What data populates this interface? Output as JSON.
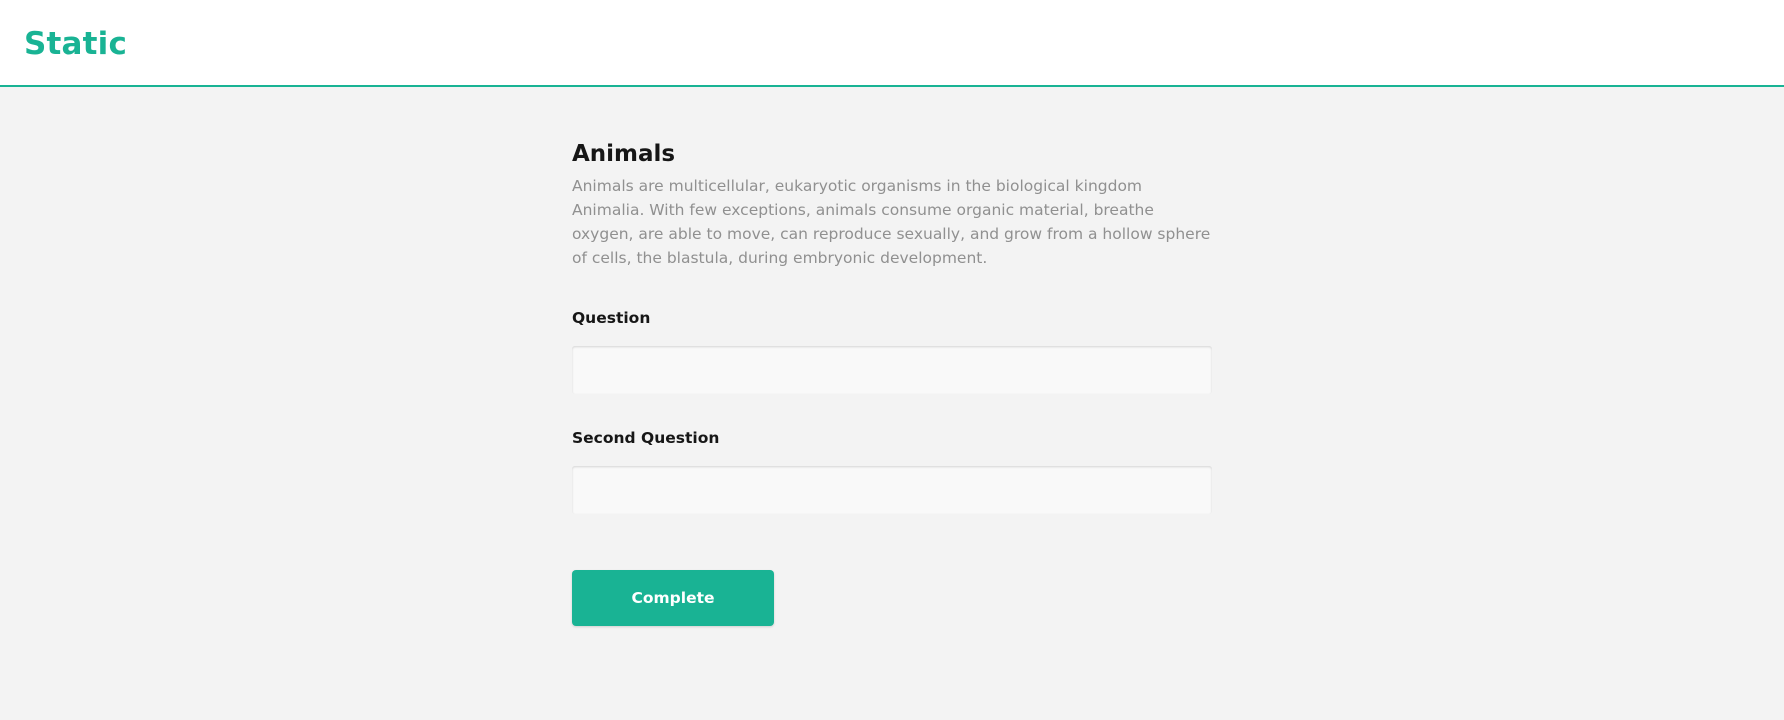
{
  "header": {
    "brand": "Static"
  },
  "survey": {
    "title": "Animals",
    "description": "Animals are multicellular, eukaryotic organisms in the biological kingdom Animalia. With few exceptions, animals consume organic material, breathe oxygen, are able to move, can reproduce sexually, and grow from a hollow sphere of cells, the blastula, during embryonic development.",
    "questions": [
      {
        "title": "Question",
        "value": ""
      },
      {
        "title": "Second Question",
        "value": ""
      }
    ],
    "complete_label": "Complete"
  },
  "colors": {
    "accent": "#19b394",
    "background": "#f3f3f3",
    "description_text": "#909090"
  }
}
